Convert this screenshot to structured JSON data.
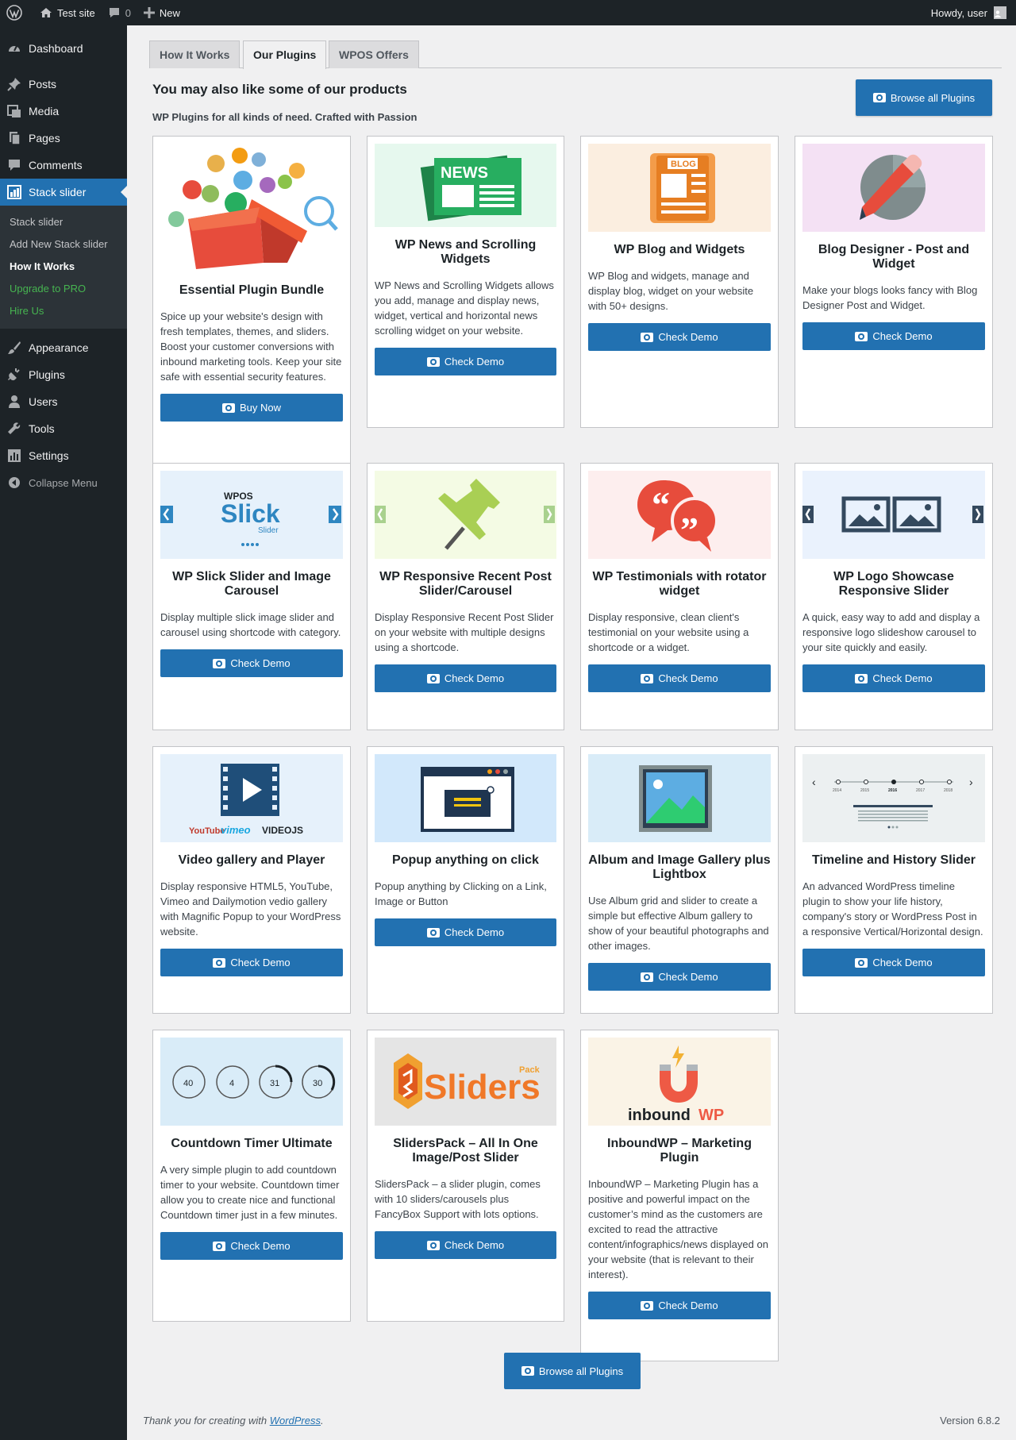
{
  "adminbar": {
    "site": "Test site",
    "comments": "0",
    "new": "New",
    "howdy": "Howdy, user"
  },
  "sidebar": {
    "items": [
      {
        "label": "Dashboard",
        "icon": "dashboard-icon"
      },
      {
        "label": "Posts",
        "icon": "pin-icon"
      },
      {
        "label": "Media",
        "icon": "media-icon"
      },
      {
        "label": "Pages",
        "icon": "pages-icon"
      },
      {
        "label": "Comments",
        "icon": "comment-icon"
      },
      {
        "label": "Stack slider",
        "icon": "slider-icon"
      }
    ],
    "submenu": [
      "Stack slider",
      "Add New Stack slider",
      "How It Works",
      "Upgrade to PRO",
      "Hire Us"
    ],
    "items2": [
      {
        "label": "Appearance",
        "icon": "brush-icon"
      },
      {
        "label": "Plugins",
        "icon": "plug-icon"
      },
      {
        "label": "Users",
        "icon": "user-icon"
      },
      {
        "label": "Tools",
        "icon": "wrench-icon"
      },
      {
        "label": "Settings",
        "icon": "settings-icon"
      }
    ],
    "collapse": "Collapse Menu"
  },
  "tabs": [
    "How It Works",
    "Our Plugins",
    "WPOS Offers"
  ],
  "heading": "You may also like some of our products",
  "subheading": "WP Plugins for all kinds of need. Crafted with Passion",
  "browse_label": "Browse all Plugins",
  "thumb_text": {
    "news": "NEWS",
    "blog": "BLOG",
    "wpos": "WPOS",
    "slick": "Slick",
    "slider": "Slider",
    "c1": "40",
    "c2": "4",
    "c3": "31",
    "c4": "30",
    "youtube": "YouTube",
    "vimeo": "vimeo",
    "videojs": "VIDEOJS",
    "sliders": "Sliders",
    "pack": "Pack",
    "inbound1": "inbound",
    "inbound2": "WP",
    "t1": "2014",
    "t2": "2015",
    "t3": "2016",
    "t4": "2017",
    "t5": "2018"
  },
  "cards": [
    {
      "title": "Essential Plugin Bundle",
      "desc": "Spice up your website's design with fresh templates, themes, and sliders. Boost your customer conversions with inbound marketing tools. Keep your site safe with essential security features.",
      "btn": "Buy Now"
    },
    {
      "title": "WP News and Scrolling Widgets",
      "desc": "WP News and Scrolling Widgets allows you add, manage and display news, widget, vertical and horizontal news scrolling widget on your website.",
      "btn": "Check Demo"
    },
    {
      "title": "WP Blog and Widgets",
      "desc": "WP Blog and widgets, manage and display blog, widget on your website with 50+ designs.",
      "btn": "Check Demo"
    },
    {
      "title": "Blog Designer - Post and Widget",
      "desc": "Make your blogs looks fancy with Blog Designer Post and Widget.",
      "btn": "Check Demo"
    },
    {
      "title": "WP Slick Slider and Image Carousel",
      "desc": "Display multiple slick image slider and carousel using shortcode with category.",
      "btn": "Check Demo"
    },
    {
      "title": "WP Responsive Recent Post Slider/Carousel",
      "desc": "Display Responsive Recent Post Slider on your website with multiple designs using a shortcode.",
      "btn": "Check Demo"
    },
    {
      "title": "WP Testimonials with rotator widget",
      "desc": "Display responsive, clean client's testimonial on your website using a shortcode or a widget.",
      "btn": "Check Demo"
    },
    {
      "title": "WP Logo Showcase Responsive Slider",
      "desc": "A quick, easy way to add and display a responsive logo slideshow carousel to your site quickly and easily.",
      "btn": "Check Demo"
    },
    {
      "title": "Video gallery and Player",
      "desc": "Display responsive HTML5, YouTube, Vimeo and Dailymotion vedio gallery with Magnific Popup to your WordPress website.",
      "btn": "Check Demo"
    },
    {
      "title": "Popup anything on click",
      "desc": "Popup anything by Clicking on a Link, Image or Button",
      "btn": "Check Demo"
    },
    {
      "title": "Album and Image Gallery plus Lightbox",
      "desc": "Use Album grid and slider to create a simple but effective Album gallery to show of your beautiful photographs and other images.",
      "btn": "Check Demo"
    },
    {
      "title": "Timeline and History Slider",
      "desc": "An advanced WordPress timeline plugin to show your life history, company's story or WordPress Post in a responsive Vertical/Horizontal design.",
      "btn": "Check Demo"
    },
    {
      "title": "Countdown Timer Ultimate",
      "desc": "A very simple plugin to add countdown timer to your website. Countdown timer allow you to create nice and functional Countdown timer just in a few minutes.",
      "btn": "Check Demo"
    },
    {
      "title": "SlidersPack – All In One Image/Post Slider",
      "desc": "SlidersPack – a slider plugin, comes with 10 sliders/carousels plus FancyBox Support with lots options.",
      "btn": "Check Demo"
    },
    {
      "title": "InboundWP – Marketing Plugin",
      "desc": "InboundWP – Marketing Plugin has a positive and powerful impact on the customer’s mind as the customers are excited to read the attractive content/infographics/news displayed on your website (that is relevant to their interest).",
      "btn": "Check Demo"
    }
  ],
  "footer": {
    "thanks_pre": "Thank you for creating with ",
    "link": "WordPress",
    "thanks_post": ".",
    "version": "Version 6.8.2"
  },
  "colors": {
    "accent": "#2271b1",
    "sidebar": "#1d2327",
    "upgrade": "#46b450"
  }
}
